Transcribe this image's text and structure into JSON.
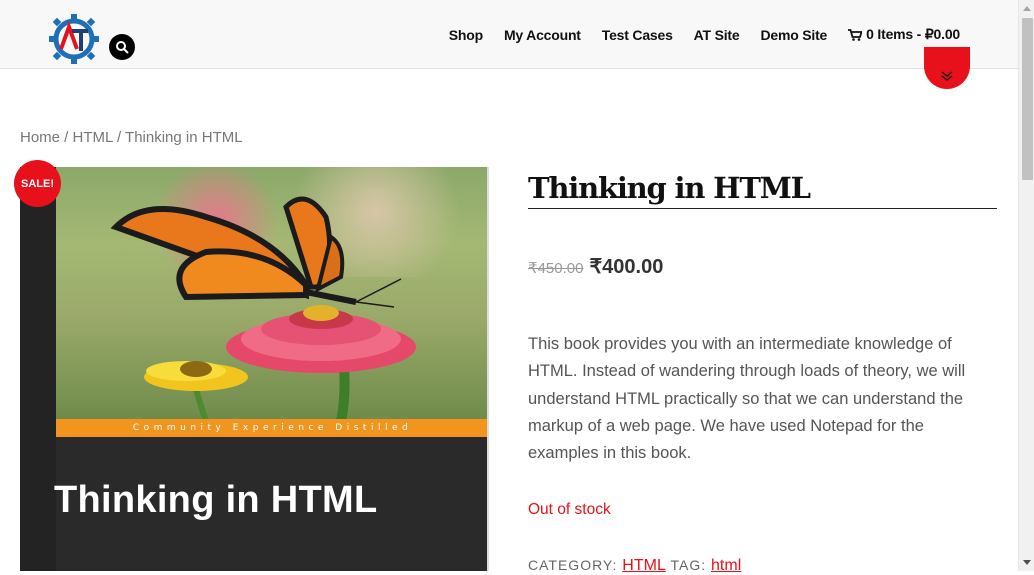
{
  "header": {
    "nav": [
      "Shop",
      "My Account",
      "Test Cases",
      "AT Site",
      "Demo Site"
    ],
    "cart_label": "0 Items - ₽0.00",
    "logo_text": "AT"
  },
  "breadcrumb": {
    "home": "Home",
    "sep": " / ",
    "category": "HTML",
    "current": "Thinking in HTML"
  },
  "product": {
    "sale_badge": "SALE!",
    "title": "Thinking in HTML",
    "old_price": "₹450.00",
    "new_price": "₹400.00",
    "description": "This book provides you with an intermediate knowledge of HTML. Instead of wandering through loads of theory, we will understand HTML practically so that we can understand the markup of a web page. We have used Notepad for the examples in this book.",
    "stock": "Out of stock",
    "category_label": "CATEGORY:",
    "category_value": "HTML",
    "tag_label": "TAG:",
    "tag_value": "html"
  },
  "cover": {
    "band_text": "Community Experience Distilled",
    "title": "Thinking in HTML"
  },
  "colors": {
    "accent": "#e8111b",
    "cover_band": "#f1951f"
  }
}
